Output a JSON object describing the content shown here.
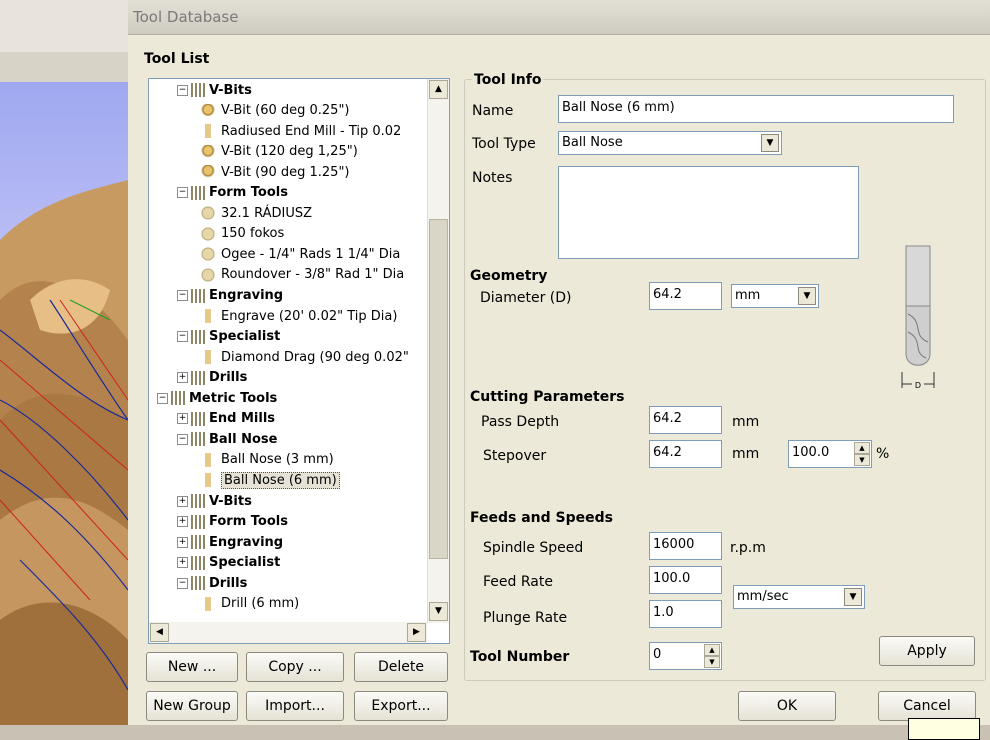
{
  "window": {
    "title": "Tool Database"
  },
  "tool_list": {
    "label": "Tool List",
    "nodes": [
      {
        "label": "V-Bits",
        "group": true,
        "expanded": true,
        "level": 1
      },
      {
        "label": "V-Bit (60 deg 0.25\")",
        "icon": "vbit",
        "level": 2
      },
      {
        "label": "Radiused End Mill - Tip 0.02",
        "icon": "mill",
        "level": 2
      },
      {
        "label": "V-Bit (120 deg 1,25\")",
        "icon": "vbit",
        "level": 2
      },
      {
        "label": "V-Bit (90 deg 1.25\")",
        "icon": "vbit",
        "level": 2
      },
      {
        "label": "Form Tools",
        "group": true,
        "expanded": true,
        "level": 1
      },
      {
        "label": "32.1 RÁDIUSZ",
        "icon": "form",
        "level": 2
      },
      {
        "label": "150 fokos",
        "icon": "form",
        "level": 2
      },
      {
        "label": "Ogee - 1/4\" Rads 1 1/4\" Dia",
        "icon": "form",
        "level": 2
      },
      {
        "label": "Roundover - 3/8\" Rad 1\" Dia",
        "icon": "form",
        "level": 2
      },
      {
        "label": "Engraving",
        "group": true,
        "expanded": true,
        "level": 1
      },
      {
        "label": "Engrave (20' 0.02\" Tip Dia)",
        "icon": "mill",
        "level": 2
      },
      {
        "label": "Specialist",
        "group": true,
        "expanded": true,
        "level": 1
      },
      {
        "label": "Diamond Drag (90 deg 0.02\"",
        "icon": "mill",
        "level": 2
      },
      {
        "label": "Drills",
        "group": true,
        "expanded": false,
        "level": 1
      },
      {
        "label": "Metric Tools",
        "group": true,
        "expanded": true,
        "level": 0
      },
      {
        "label": "End Mills",
        "group": true,
        "expanded": false,
        "level": 1
      },
      {
        "label": "Ball Nose",
        "group": true,
        "expanded": true,
        "level": 1
      },
      {
        "label": "Ball Nose (3 mm)",
        "icon": "mill",
        "level": 2
      },
      {
        "label": "Ball Nose (6 mm)",
        "icon": "mill",
        "level": 2,
        "selected": true
      },
      {
        "label": "V-Bits",
        "group": true,
        "expanded": false,
        "level": 1
      },
      {
        "label": "Form Tools",
        "group": true,
        "expanded": false,
        "level": 1
      },
      {
        "label": "Engraving",
        "group": true,
        "expanded": false,
        "level": 1
      },
      {
        "label": "Specialist",
        "group": true,
        "expanded": false,
        "level": 1
      },
      {
        "label": "Drills",
        "group": true,
        "expanded": true,
        "level": 1
      },
      {
        "label": "Drill (6 mm)",
        "icon": "mill",
        "level": 2
      }
    ],
    "buttons": {
      "new": "New ...",
      "copy": "Copy ...",
      "delete": "Delete",
      "new_group": "New Group",
      "import": "Import...",
      "export": "Export..."
    }
  },
  "tool_info": {
    "label": "Tool Info",
    "name_label": "Name",
    "name_value": "Ball Nose (6 mm)",
    "type_label": "Tool Type",
    "type_value": "Ball Nose",
    "notes_label": "Notes",
    "notes_value": ""
  },
  "geometry": {
    "label": "Geometry",
    "diameter_label": "Diameter (D)",
    "diameter_value": "64.2",
    "unit": "mm",
    "image_dim_label": "D"
  },
  "cutting": {
    "label": "Cutting Parameters",
    "pass_depth_label": "Pass Depth",
    "pass_depth_value": "64.2",
    "pass_depth_unit": "mm",
    "stepover_label": "Stepover",
    "stepover_value": "64.2",
    "stepover_unit": "mm",
    "stepover_percent": "100.0",
    "percent_sign": "%"
  },
  "feeds": {
    "label": "Feeds and Speeds",
    "spindle_label": "Spindle Speed",
    "spindle_value": "16000",
    "spindle_unit": "r.p.m",
    "feed_label": "Feed Rate",
    "feed_value": "100.0",
    "plunge_label": "Plunge Rate",
    "plunge_value": "1.0",
    "rate_unit": "mm/sec"
  },
  "tool_number": {
    "label": "Tool Number",
    "value": "0"
  },
  "actions": {
    "apply": "Apply",
    "ok": "OK",
    "cancel": "Cancel"
  },
  "colors": {
    "selection": "#e6e3d6",
    "title_text": "#7a7a7a",
    "dialog_bg": "#ece9d8"
  }
}
